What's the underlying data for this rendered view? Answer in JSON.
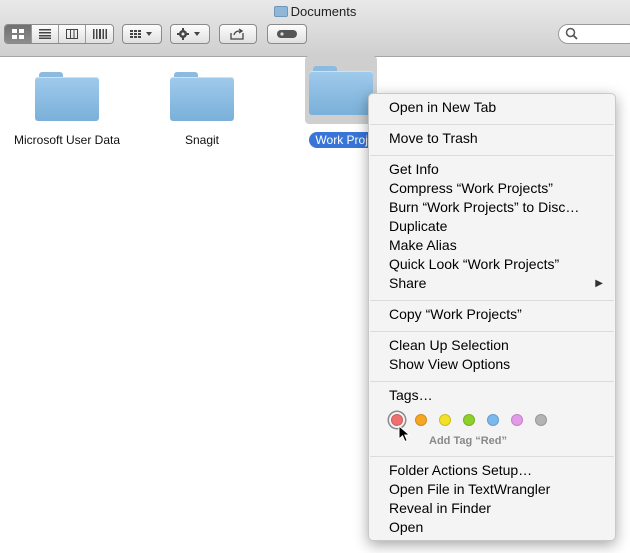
{
  "window": {
    "title": "Documents"
  },
  "toolbar": {
    "view_buttons": [
      "icon-view",
      "list-view",
      "column-view",
      "coverflow-view"
    ],
    "active_view": 0
  },
  "folders": [
    {
      "name": "Microsoft User Data",
      "selected": false
    },
    {
      "name": "Snagit",
      "selected": false
    },
    {
      "name": "Work Projects",
      "selected": true,
      "display": "Work Projec"
    }
  ],
  "menu": {
    "items": [
      "Open in New Tab",
      "Move to Trash",
      "Get Info",
      "Compress “Work Projects”",
      "Burn “Work Projects” to Disc…",
      "Duplicate",
      "Make Alias",
      "Quick Look “Work Projects”",
      "Share",
      "Copy “Work Projects”",
      "Clean Up Selection",
      "Show View Options",
      "Tags…",
      "Folder Actions Setup…",
      "Open File in TextWrangler",
      "Reveal in Finder",
      "Open"
    ],
    "submenu_arrow": "▶",
    "tag_colors": [
      "#ef6f6f",
      "#f5a623",
      "#f2e127",
      "#8ed02a",
      "#7bb8ee",
      "#e39ae8",
      "#b3b3b3"
    ],
    "tag_hint": "Add Tag “Red”"
  },
  "icons": {
    "folder": "folder-icon",
    "gear": "gear-icon",
    "share": "share-icon",
    "search": "search-icon"
  }
}
